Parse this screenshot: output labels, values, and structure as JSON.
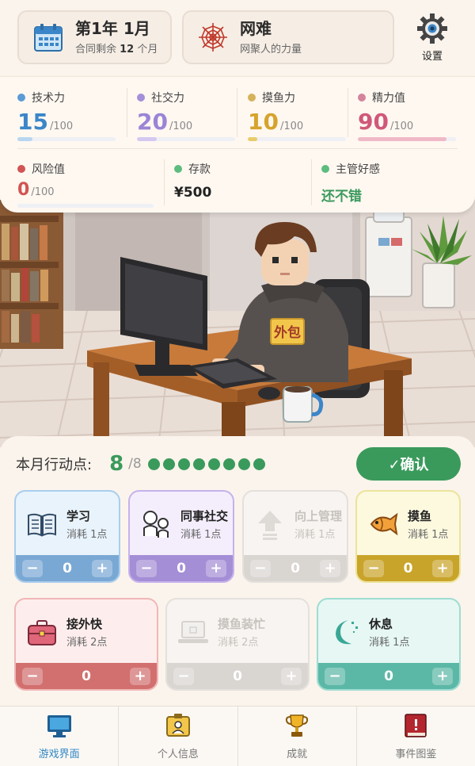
{
  "header": {
    "date_main": "第1年 1月",
    "date_sub_prefix": "合同剩余 ",
    "date_sub_num": "12",
    "date_sub_suffix": " 个月",
    "title": "网难",
    "subtitle": "网聚人的力量",
    "settings_label": "设置"
  },
  "stats": [
    {
      "label": "技术力",
      "value": "15",
      "max": "/100",
      "color": "#3b86c8",
      "fill": 0.15
    },
    {
      "label": "社交力",
      "value": "20",
      "max": "/100",
      "color": "#9b84d6",
      "fill": 0.2
    },
    {
      "label": "摸鱼力",
      "value": "10",
      "max": "/100",
      "color": "#d6a42c",
      "fill": 0.1
    },
    {
      "label": "精力值",
      "value": "90",
      "max": "/100",
      "color": "#d0587a",
      "fill": 0.9
    }
  ],
  "stats2": {
    "risk": {
      "label": "风险值",
      "value": "0",
      "max": "/100",
      "color": "#d25454",
      "fill": 0.0
    },
    "savings": {
      "label": "存款",
      "value": "¥500",
      "color": "#5cbd7e"
    },
    "boss": {
      "label": "主管好感",
      "value": "还不错",
      "color": "#5cbd7e"
    }
  },
  "scene": {
    "badge": "外包"
  },
  "action_points": {
    "label": "本月行动点:",
    "current": "8",
    "max": "/8",
    "dots": 8,
    "confirm_label": "✓确认"
  },
  "actions": [
    {
      "name": "学习",
      "cost": "消耗 1点",
      "count": "0",
      "icon": "book-icon"
    },
    {
      "name": "同事社交",
      "cost": "消耗 1点",
      "count": "0",
      "icon": "people-icon"
    },
    {
      "name": "向上管理",
      "cost": "消耗 1点",
      "count": "0",
      "icon": "up-arrow-icon"
    },
    {
      "name": "摸鱼",
      "cost": "消耗 1点",
      "count": "0",
      "icon": "fish-icon"
    },
    {
      "name": "接外快",
      "cost": "消耗 2点",
      "count": "0",
      "icon": "briefcase-icon"
    },
    {
      "name": "摸鱼装忙",
      "cost": "消耗 2点",
      "count": "0",
      "icon": "laptop-icon"
    },
    {
      "name": "休息",
      "cost": "消耗 1点",
      "count": "0",
      "icon": "moon-icon"
    }
  ],
  "nav": [
    {
      "label": "游戏界面",
      "active": true,
      "icon": "monitor-icon"
    },
    {
      "label": "个人信息",
      "active": false,
      "icon": "id-badge-icon"
    },
    {
      "label": "成就",
      "active": false,
      "icon": "trophy-icon"
    },
    {
      "label": "事件图鉴",
      "active": false,
      "icon": "book-red-icon"
    }
  ],
  "colors": {
    "accent_green": "#3a9a5c",
    "active_nav": "#2f86c4"
  }
}
